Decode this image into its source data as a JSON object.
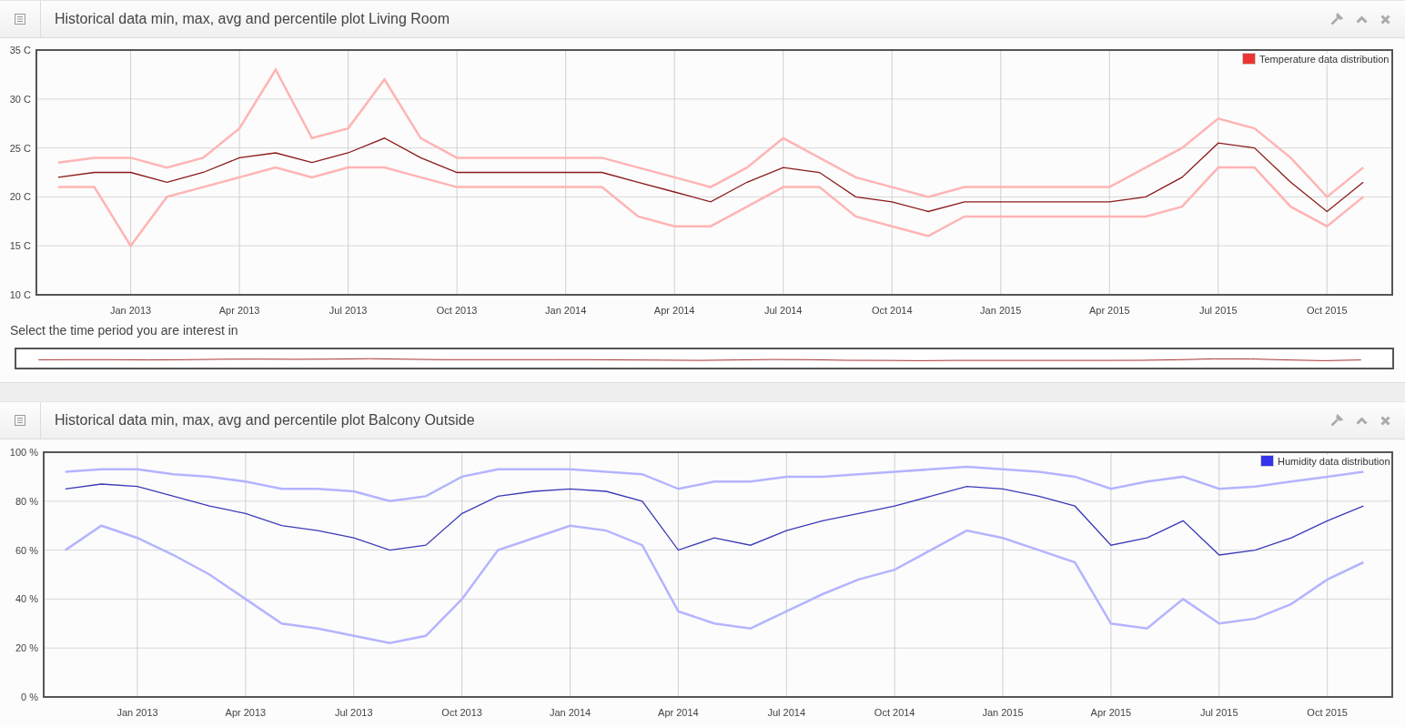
{
  "panels": [
    {
      "title": "Historical data min, max, avg and percentile plot Living Room",
      "legend": {
        "label": "Temperature data distribution",
        "color": "#ee3333"
      },
      "chart_data": {
        "type": "line",
        "grid": true,
        "categories": [
          null,
          null,
          "Jan 2013",
          null,
          null,
          "Apr 2013",
          null,
          null,
          "Jul 2013",
          null,
          null,
          "Oct 2013",
          null,
          null,
          "Jan 2014",
          null,
          null,
          "Apr 2014",
          null,
          null,
          "Jul 2014",
          null,
          null,
          "Oct 2014",
          null,
          null,
          "Jan 2015",
          null,
          null,
          "Apr 2015",
          null,
          null,
          "Jul 2015",
          null,
          null,
          "Oct 2015",
          null
        ],
        "ylim": [
          10,
          35
        ],
        "yticks": [
          {
            "value": 10,
            "label": "10 C"
          },
          {
            "value": 15,
            "label": "15 C"
          },
          {
            "value": 20,
            "label": "20 C"
          },
          {
            "value": 25,
            "label": "25 C"
          },
          {
            "value": 30,
            "label": "30 C"
          },
          {
            "value": 35,
            "label": "35 C"
          }
        ],
        "series": [
          {
            "color": "#ffb4b4",
            "values": [
              23.5,
              24,
              24,
              23,
              24,
              27,
              33,
              26,
              27,
              32,
              26,
              24,
              24,
              24,
              24,
              24,
              23,
              22,
              21,
              23,
              26,
              24,
              22,
              21,
              20,
              21,
              21,
              21,
              21,
              21,
              23,
              25,
              28,
              27,
              24,
              20,
              23
            ]
          },
          {
            "color": "#ffb4b4",
            "values": [
              21,
              21,
              15,
              20,
              21,
              22,
              23,
              22,
              23,
              23,
              22,
              21,
              21,
              21,
              21,
              21,
              18,
              17,
              17,
              19,
              21,
              21,
              18,
              17,
              16,
              18,
              18,
              18,
              18,
              18,
              18,
              19,
              23,
              23,
              19,
              17,
              20
            ]
          },
          {
            "color": "#8b1a1a",
            "values": [
              22,
              22.5,
              22.5,
              21.5,
              22.5,
              24,
              24.5,
              23.5,
              24.5,
              26,
              24,
              22.5,
              22.5,
              22.5,
              22.5,
              22.5,
              21.5,
              20.5,
              19.5,
              21.5,
              23,
              22.5,
              20,
              19.5,
              18.5,
              19.5,
              19.5,
              19.5,
              19.5,
              19.5,
              20,
              22,
              25.5,
              25,
              21.5,
              18.5,
              21.5
            ]
          }
        ]
      },
      "navigator_label": "Select the time period you are interest in"
    },
    {
      "title": "Historical data min, max, avg and percentile plot Balcony Outside",
      "legend": {
        "label": "Humidity data distribution",
        "color": "#3333ee"
      },
      "chart_data": {
        "type": "line",
        "grid": true,
        "categories": [
          null,
          null,
          "Jan 2013",
          null,
          null,
          "Apr 2013",
          null,
          null,
          "Jul 2013",
          null,
          null,
          "Oct 2013",
          null,
          null,
          "Jan 2014",
          null,
          null,
          "Apr 2014",
          null,
          null,
          "Jul 2014",
          null,
          null,
          "Oct 2014",
          null,
          null,
          "Jan 2015",
          null,
          null,
          "Apr 2015",
          null,
          null,
          "Jul 2015",
          null,
          null,
          "Oct 2015",
          null
        ],
        "ylim": [
          0,
          100
        ],
        "yticks": [
          {
            "value": 0,
            "label": "0 %"
          },
          {
            "value": 20,
            "label": "20 %"
          },
          {
            "value": 40,
            "label": "40 %"
          },
          {
            "value": 60,
            "label": "60 %"
          },
          {
            "value": 80,
            "label": "80 %"
          },
          {
            "value": 100,
            "label": "100 %"
          }
        ],
        "series": [
          {
            "color": "#b4b4ff",
            "values": [
              92,
              93,
              93,
              91,
              90,
              88,
              85,
              85,
              84,
              80,
              82,
              90,
              93,
              93,
              93,
              92,
              91,
              85,
              88,
              88,
              90,
              90,
              91,
              92,
              93,
              94,
              93,
              92,
              90,
              85,
              88,
              90,
              85,
              86,
              88,
              90,
              92
            ]
          },
          {
            "color": "#b4b4ff",
            "values": [
              60,
              70,
              65,
              58,
              50,
              40,
              30,
              28,
              25,
              22,
              25,
              40,
              60,
              65,
              70,
              68,
              62,
              35,
              30,
              28,
              35,
              42,
              48,
              52,
              60,
              68,
              65,
              60,
              55,
              30,
              28,
              40,
              30,
              32,
              38,
              48,
              55
            ]
          },
          {
            "color": "#3b3bb8",
            "values": [
              85,
              87,
              86,
              82,
              78,
              75,
              70,
              68,
              65,
              60,
              62,
              75,
              82,
              84,
              85,
              84,
              80,
              60,
              65,
              62,
              68,
              72,
              75,
              78,
              82,
              86,
              85,
              82,
              78,
              62,
              65,
              72,
              58,
              60,
              65,
              72,
              78
            ]
          }
        ]
      }
    }
  ]
}
